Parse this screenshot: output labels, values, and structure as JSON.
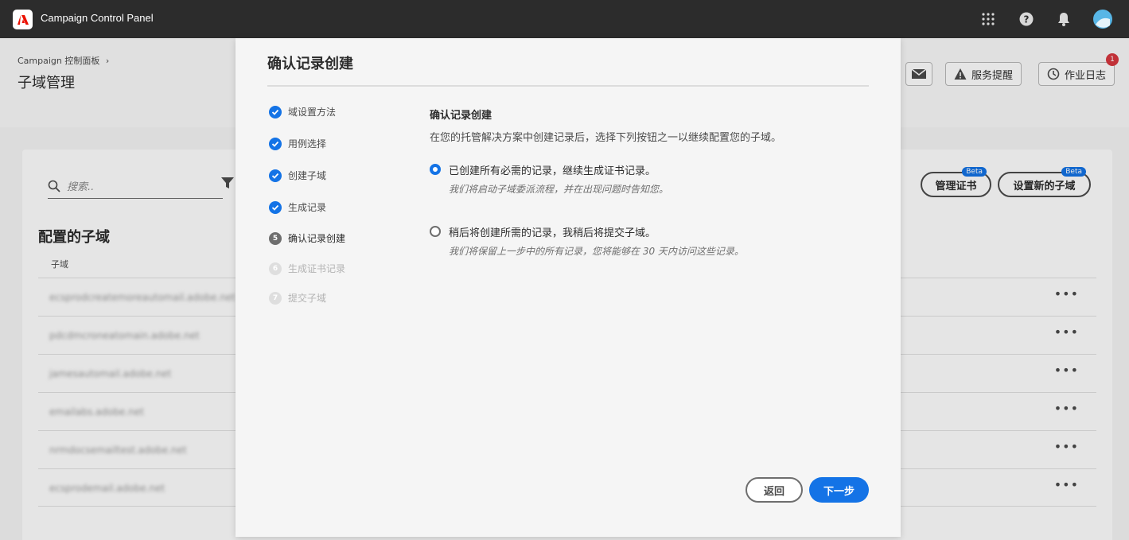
{
  "app": {
    "title": "Campaign Control Panel",
    "accent": "#1473e6",
    "topbar_bg": "#2c2c2c",
    "icons": [
      "apps-grid-icon",
      "help-icon",
      "bell-icon",
      "avatar"
    ]
  },
  "page": {
    "breadcrumb": "Campaign 控制面板",
    "breadcrumb_chevron": "›",
    "title": "子域管理",
    "header_buttons": {
      "service_alerts": "服务提醒",
      "job_log": "作业日志",
      "job_log_badge": "1"
    },
    "search_placeholder": "搜索..",
    "manage_cert": "管理证书",
    "setup_subdomain": "设置新的子域",
    "beta": "Beta",
    "section_title": "配置的子域",
    "column_header": "子域",
    "rows": [
      "ecsprodcreatemoreautomail.adobe.net",
      "pdcdmcroneatomain.adobe.net",
      "jamesautomail.adobe.net",
      "emailabs.adobe.net",
      "nrmdocsemailtest.adobe.net",
      "ecsprodemail.adobe.net"
    ],
    "row_more": "•••"
  },
  "modal": {
    "title": "确认记录创建",
    "steps": [
      {
        "label": "域设置方法",
        "state": "done",
        "num": "1"
      },
      {
        "label": "用例选择",
        "state": "done",
        "num": "2"
      },
      {
        "label": "创建子域",
        "state": "done",
        "num": "3"
      },
      {
        "label": "生成记录",
        "state": "done",
        "num": "4"
      },
      {
        "label": "确认记录创建",
        "state": "current",
        "num": "5"
      },
      {
        "label": "生成证书记录",
        "state": "todo",
        "num": "6"
      },
      {
        "label": "提交子域",
        "state": "todo",
        "num": "7"
      }
    ],
    "content": {
      "heading": "确认记录创建",
      "description": "在您的托管解决方案中创建记录后，选择下列按钮之一以继续配置您的子域。",
      "options": [
        {
          "label": "已创建所有必需的记录，继续生成证书记录。",
          "help": "我们将启动子域委派流程，并在出现问题时告知您。",
          "checked": true
        },
        {
          "label": "稍后将创建所需的记录，我稍后将提交子域。",
          "help": "我们将保留上一步中的所有记录，您将能够在 30 天内访问这些记录。",
          "checked": false
        }
      ]
    },
    "back_label": "返回",
    "next_label": "下一步"
  }
}
